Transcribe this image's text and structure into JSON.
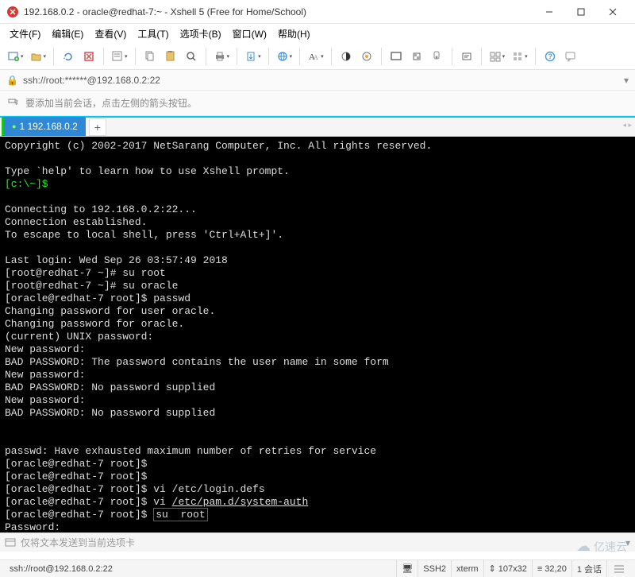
{
  "window": {
    "title": "192.168.0.2 - oracle@redhat-7:~ - Xshell 5 (Free for Home/School)"
  },
  "menu": {
    "file": "文件(F)",
    "edit": "编辑(E)",
    "view": "查看(V)",
    "tools": "工具(T)",
    "tabs": "选项卡(B)",
    "window": "窗口(W)",
    "help": "帮助(H)"
  },
  "address": {
    "url": "ssh://root:******@192.168.0.2:22"
  },
  "hint": {
    "text": "要添加当前会话，点击左侧的箭头按钮。"
  },
  "tab": {
    "label": "1 192.168.0.2"
  },
  "terminal": {
    "copyright": "Copyright (c) 2002-2017 NetSarang Computer, Inc. All rights reserved.",
    "help": "Type `help' to learn how to use Xshell prompt.",
    "prompt_local": "[c:\\~]$",
    "connecting": "Connecting to 192.168.0.2:22...",
    "established": "Connection established.",
    "escape": "To escape to local shell, press 'Ctrl+Alt+]'.",
    "lastlogin": "Last login: Wed Sep 26 03:57:49 2018",
    "p_root1": "[root@redhat-7 ~]# ",
    "cmd_su_root": "su root",
    "p_root2": "[root@redhat-7 ~]# ",
    "cmd_su_oracle": "su oracle",
    "p_oracle": "[oracle@redhat-7 root]$ ",
    "cmd_passwd": "passwd",
    "chg1": "Changing password for user oracle.",
    "chg2": "Changing password for oracle.",
    "curpw": "(current) UNIX password:",
    "newpw": "New password:",
    "bad1": "BAD PASSWORD: The password contains the user name in some form",
    "bad2": "BAD PASSWORD: No password supplied",
    "bad3": "BAD PASSWORD: No password supplied",
    "exhaust": "passwd: Have exhausted maximum number of retries for service",
    "cmd_vi1": "vi /etc/login.defs",
    "cmd_vi2_pre": "vi ",
    "cmd_vi2_u": "/etc/pam.d/system-auth",
    "cmd_su_root2": "su  root",
    "pw_prompt": "Password:",
    "p_root_last": "[root@redhat-7 ~]# "
  },
  "sendbar": {
    "text": "仅将文本发送到当前选项卡"
  },
  "status": {
    "addr": "ssh://root@192.168.0.2:22",
    "ssh2": "SSH2",
    "term": "xterm",
    "size": "107x32",
    "pos": "32,20",
    "sess": "1 会话"
  },
  "watermark": {
    "text": "亿速云"
  },
  "icons": {
    "lock": "🔒",
    "dd": "▾",
    "dot": "●",
    "monitor": "🖥",
    "cloud": "☁"
  }
}
